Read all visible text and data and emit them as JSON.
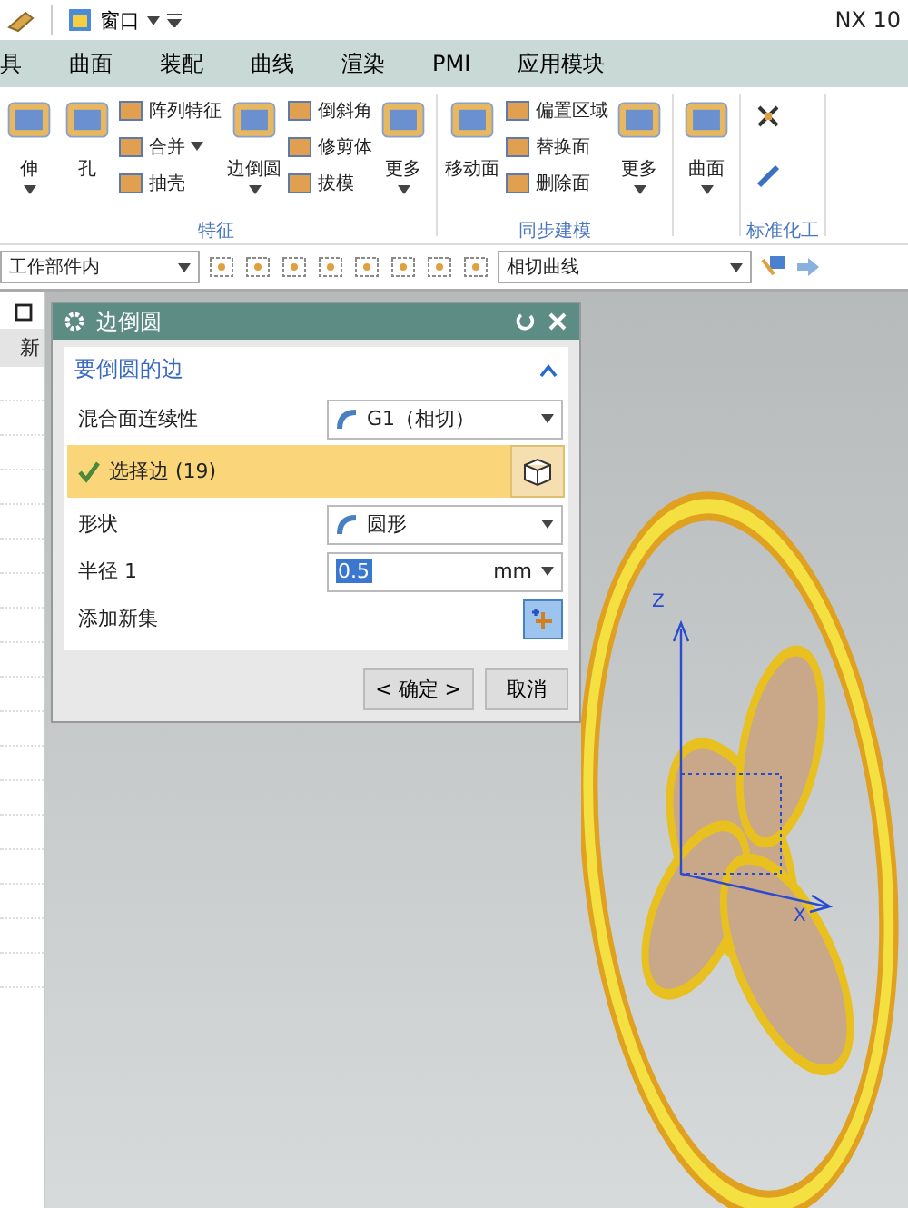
{
  "quick_access": {
    "menu_label": "窗口"
  },
  "app_title": "NX 10",
  "menu_tabs": [
    {
      "label": "具"
    },
    {
      "label": "曲面"
    },
    {
      "label": "装配"
    },
    {
      "label": "曲线"
    },
    {
      "label": "渲染"
    },
    {
      "label": "PMI"
    },
    {
      "label": "应用模块"
    }
  ],
  "ribbon_groups": [
    {
      "label": "特征",
      "items": [
        {
          "kind": "large",
          "label": "伸",
          "dropdown": true
        },
        {
          "kind": "large",
          "label": "孔",
          "dropdown": false
        },
        {
          "kind": "stack",
          "items": [
            {
              "label": "阵列特征",
              "dropdown": false
            },
            {
              "label": "合并",
              "dropdown": true
            },
            {
              "label": "抽壳",
              "dropdown": false
            }
          ]
        },
        {
          "kind": "large",
          "label": "边倒圆",
          "dropdown": true
        },
        {
          "kind": "stack",
          "items": [
            {
              "label": "倒斜角",
              "dropdown": false
            },
            {
              "label": "修剪体",
              "dropdown": false
            },
            {
              "label": "拔模",
              "dropdown": false
            }
          ]
        },
        {
          "kind": "large",
          "label": "更多",
          "dropdown": true
        }
      ]
    },
    {
      "label": "同步建模",
      "items": [
        {
          "kind": "large",
          "label": "移动面",
          "dropdown": false
        },
        {
          "kind": "stack",
          "items": [
            {
              "label": "偏置区域",
              "dropdown": false
            },
            {
              "label": "替换面",
              "dropdown": false
            },
            {
              "label": "删除面",
              "dropdown": false
            }
          ]
        },
        {
          "kind": "large",
          "label": "更多",
          "dropdown": true
        }
      ]
    },
    {
      "items": [
        {
          "kind": "large",
          "label": "曲面",
          "dropdown": true
        }
      ]
    },
    {
      "label": "标准化工",
      "items": [
        {
          "kind": "icons"
        }
      ]
    }
  ],
  "selection_bar": {
    "filter": "工作部件内",
    "curve_rule": "相切曲线"
  },
  "left_panel": {
    "header": "新"
  },
  "dialog": {
    "title": "边倒圆",
    "section": {
      "title": "要倒圆的边",
      "expanded": true
    },
    "rows": [
      {
        "kind": "dropdown",
        "label": "混合面连续性",
        "value": "G1（相切）"
      },
      {
        "kind": "selection",
        "label": "选择边 (19)",
        "checked": true
      },
      {
        "kind": "dropdown",
        "label": "形状",
        "value": "圆形"
      },
      {
        "kind": "input",
        "label": "半径 1",
        "value": "0.5",
        "unit": "mm"
      },
      {
        "kind": "add",
        "label": "添加新集"
      }
    ],
    "buttons": [
      "< 确定 >",
      "取消"
    ]
  },
  "viewport": {
    "axes": [
      "Z",
      "X"
    ]
  }
}
